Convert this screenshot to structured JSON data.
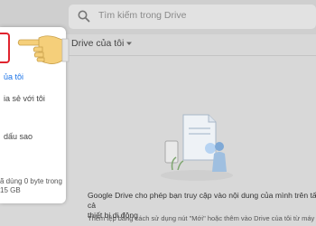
{
  "search": {
    "placeholder": "Tìm kiếm trong Drive"
  },
  "sidebar": {
    "items": [
      {
        "label": "ủa tôi",
        "active": true
      },
      {
        "label": "ia sẻ với tôi",
        "active": false
      },
      {
        "label": "dấu sao",
        "active": false
      }
    ]
  },
  "storage": {
    "line1": "ã dùng 0 byte trong",
    "line2": "15 GB"
  },
  "main": {
    "title": "Drive của tôi",
    "info_line1": "Google Drive cho phép bạn truy cập vào nội dung của mình trên tất cả",
    "info_line2": "thiết bị di động",
    "info_sub": "Thêm tệp bằng cách sử dụng nút \"Mới\" hoặc thêm vào Drive của tôi từ máy"
  },
  "colors": {
    "accent": "#1a73e8",
    "highlight_border": "#e0242e",
    "hand": "#f5cf7a"
  }
}
